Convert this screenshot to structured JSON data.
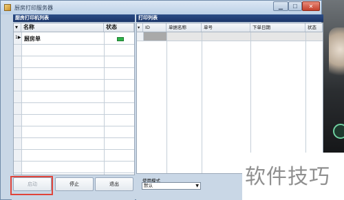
{
  "window": {
    "title": "厨房打印服务器"
  },
  "printers_panel": {
    "title": "厨房打印机列表",
    "columns": [
      "名称",
      "状态"
    ],
    "rows": [
      {
        "name": "厨房单",
        "status_color": "#2fb44a"
      }
    ]
  },
  "print_list_panel": {
    "title": "打印列表",
    "columns": [
      "ID",
      "单据名称",
      "单号",
      "下单日期",
      "状态"
    ]
  },
  "buttons": {
    "start": "启动",
    "stop": "停止",
    "exit": "退出"
  },
  "mode": {
    "label": "使用模式",
    "value": "默认"
  },
  "watermark": {
    "text": "软件技巧"
  },
  "colors": {
    "highlight": "#e0443a",
    "panel_title_bg": "#2b4c86",
    "window_bg": "#c9d7e6"
  }
}
